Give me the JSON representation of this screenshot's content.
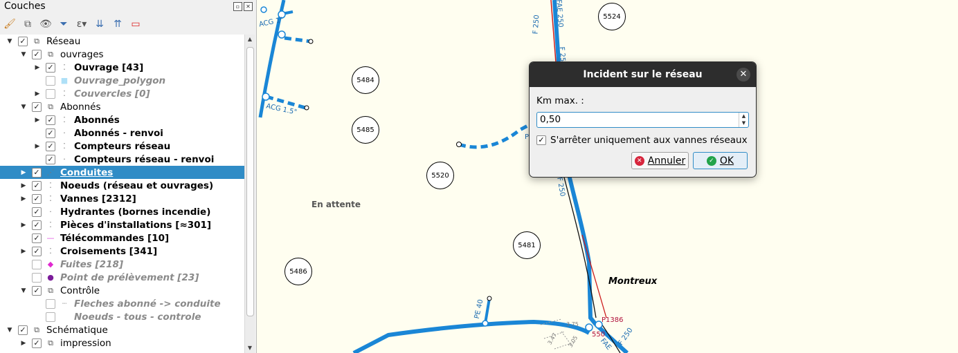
{
  "panel": {
    "title": "Couches",
    "float_icon": "float-icon",
    "close_icon": "close-icon"
  },
  "toolbar": [
    "paint-brush-icon",
    "add-group-icon",
    "eye-icon",
    "filter-icon",
    "expression-filter-icon",
    "expand-all-icon",
    "collapse-all-icon",
    "remove-layer-icon"
  ],
  "layers": [
    {
      "label": "Réseau",
      "arrow": "expanded",
      "checked": true,
      "icon": "group-icon",
      "style": "normal"
    },
    {
      "label": "ouvrages",
      "arrow": "expanded",
      "checked": true,
      "icon": "group-icon",
      "style": "normal"
    },
    {
      "label": "Ouvrage [43]",
      "arrow": "collapsed",
      "checked": true,
      "icon": "point-layer-icon",
      "style": "bold"
    },
    {
      "label": "Ouvrage_polygon",
      "arrow": "",
      "checked": false,
      "icon": "polygon-layer-icon",
      "style": "italic-grey"
    },
    {
      "label": "Couvercles [0]",
      "arrow": "collapsed",
      "checked": false,
      "icon": "point-layer-icon",
      "style": "italic-grey"
    },
    {
      "label": "Abonnés",
      "arrow": "expanded",
      "checked": true,
      "icon": "group-icon",
      "style": "normal"
    },
    {
      "label": "Abonnés",
      "arrow": "collapsed",
      "checked": true,
      "icon": "point-layer-icon",
      "style": "bold"
    },
    {
      "label": "Abonnés - renvoi",
      "arrow": "",
      "checked": true,
      "icon": "dot-icon",
      "style": "bold"
    },
    {
      "label": "Compteurs réseau",
      "arrow": "collapsed",
      "checked": true,
      "icon": "point-layer-icon",
      "style": "bold"
    },
    {
      "label": "Compteurs réseau - renvoi",
      "arrow": "",
      "checked": true,
      "icon": "dot-icon",
      "style": "bold"
    },
    {
      "label": "Conduites",
      "arrow": "collapsed",
      "checked": true,
      "icon": "line-layer-icon",
      "style": "selected"
    },
    {
      "label": "Noeuds (réseau et ouvrages)",
      "arrow": "collapsed",
      "checked": true,
      "icon": "point-layer-icon",
      "style": "bold"
    },
    {
      "label": "Vannes [2312]",
      "arrow": "collapsed",
      "checked": true,
      "icon": "point-layer-icon",
      "style": "bold"
    },
    {
      "label": "Hydrantes (bornes incendie)",
      "arrow": "",
      "checked": true,
      "icon": "dot-icon",
      "style": "bold"
    },
    {
      "label": "Pièces d'installations [≈301]",
      "arrow": "collapsed",
      "checked": true,
      "icon": "point-layer-icon",
      "style": "bold"
    },
    {
      "label": "Télécommandes [10]",
      "arrow": "",
      "checked": true,
      "icon": "pink-line-icon",
      "style": "bold"
    },
    {
      "label": "Croisements [341]",
      "arrow": "collapsed",
      "checked": true,
      "icon": "point-layer-icon",
      "style": "bold"
    },
    {
      "label": "Fuites [218]",
      "arrow": "",
      "checked": false,
      "icon": "pink-diamond-icon",
      "style": "italic-grey"
    },
    {
      "label": "Point de prélèvement [23]",
      "arrow": "",
      "checked": false,
      "icon": "purple-dot-icon",
      "style": "italic-grey"
    },
    {
      "label": "Contrôle",
      "arrow": "expanded",
      "checked": true,
      "icon": "group-icon",
      "style": "normal"
    },
    {
      "label": "Fleches abonné -> conduite",
      "arrow": "",
      "checked": false,
      "icon": "dotted-line-icon",
      "style": "italic-grey"
    },
    {
      "label": "Noeuds - tous - controle",
      "arrow": "",
      "checked": false,
      "icon": "none",
      "style": "italic-grey"
    },
    {
      "label": "Schématique",
      "arrow": "expanded",
      "checked": true,
      "icon": "group-icon",
      "style": "normal"
    },
    {
      "label": "impression",
      "arrow": "collapsed",
      "checked": true,
      "icon": "group-icon",
      "style": "normal"
    }
  ],
  "map": {
    "bubbles": [
      "5524",
      "5484",
      "5485",
      "5520",
      "5481",
      "5486"
    ],
    "labels": {
      "en_attente": "En attente",
      "montreux": "Montreux",
      "acg1": "ACG 1\"",
      "acg15": "ACG 1.5\"",
      "f250_a": "F 250",
      "fae250_a": "FAE 250",
      "f25_b": "F 25",
      "f250_c": "F 250",
      "pe40": "PE 40",
      "p1386": "P1386",
      "n550": "550",
      "fae_d": "FAE",
      "f250_d": "F 250",
      "l375": "3.75",
      "l347": "3.47",
      "l305": "3.05",
      "p_label": "P"
    },
    "colors": {
      "pipe": "#1a86d6",
      "red_line": "#cc1b1b",
      "selection": "#308cc6"
    }
  },
  "dialog": {
    "title": "Incident sur le réseau",
    "km_label": "Km max. :",
    "km_value": "0,50",
    "check_label": "S'arrêter uniquement aux vannes réseaux",
    "check_checked": true,
    "cancel_label": "Annuler",
    "ok_label": "OK"
  }
}
